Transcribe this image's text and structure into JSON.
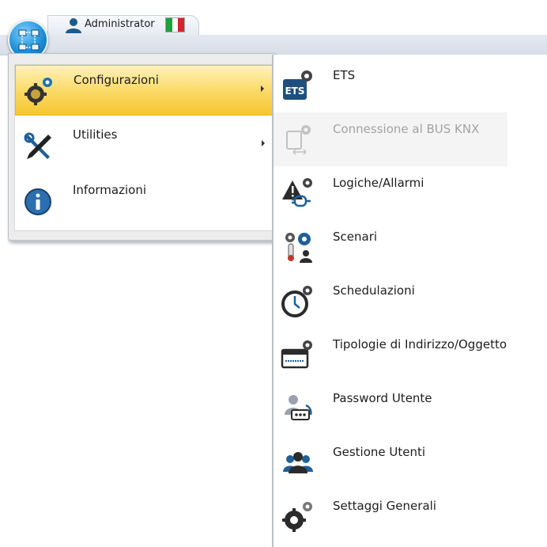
{
  "header": {
    "user_name": "Administrator",
    "flag_colors": [
      "#1f9e3a",
      "#ffffff",
      "#d6242b"
    ]
  },
  "menu": {
    "items": [
      {
        "label": "Configurazioni",
        "icon": "gears-icon",
        "selected": true,
        "has_submenu": true
      },
      {
        "label": "Utilities",
        "icon": "tools-icon",
        "selected": false,
        "has_submenu": true
      },
      {
        "label": "Informazioni",
        "icon": "info-icon",
        "selected": false,
        "has_submenu": false
      }
    ]
  },
  "submenu": {
    "items": [
      {
        "label": "ETS",
        "icon": "ets-icon",
        "enabled": true
      },
      {
        "label": "Connessione al BUS KNX",
        "icon": "bus-connection-icon",
        "enabled": false
      },
      {
        "label": "Logiche/Allarmi",
        "icon": "logic-alarm-icon",
        "enabled": true
      },
      {
        "label": "Scenari",
        "icon": "scenarios-icon",
        "enabled": true
      },
      {
        "label": "Schedulazioni",
        "icon": "schedule-clock-icon",
        "enabled": true
      },
      {
        "label": "Tipologie di Indirizzo/Oggetto",
        "icon": "address-type-icon",
        "enabled": true
      },
      {
        "label": "Password Utente",
        "icon": "user-password-icon",
        "enabled": true
      },
      {
        "label": "Gestione Utenti",
        "icon": "users-management-icon",
        "enabled": true
      },
      {
        "label": "Settaggi Generali",
        "icon": "general-settings-icon",
        "enabled": true
      }
    ]
  }
}
